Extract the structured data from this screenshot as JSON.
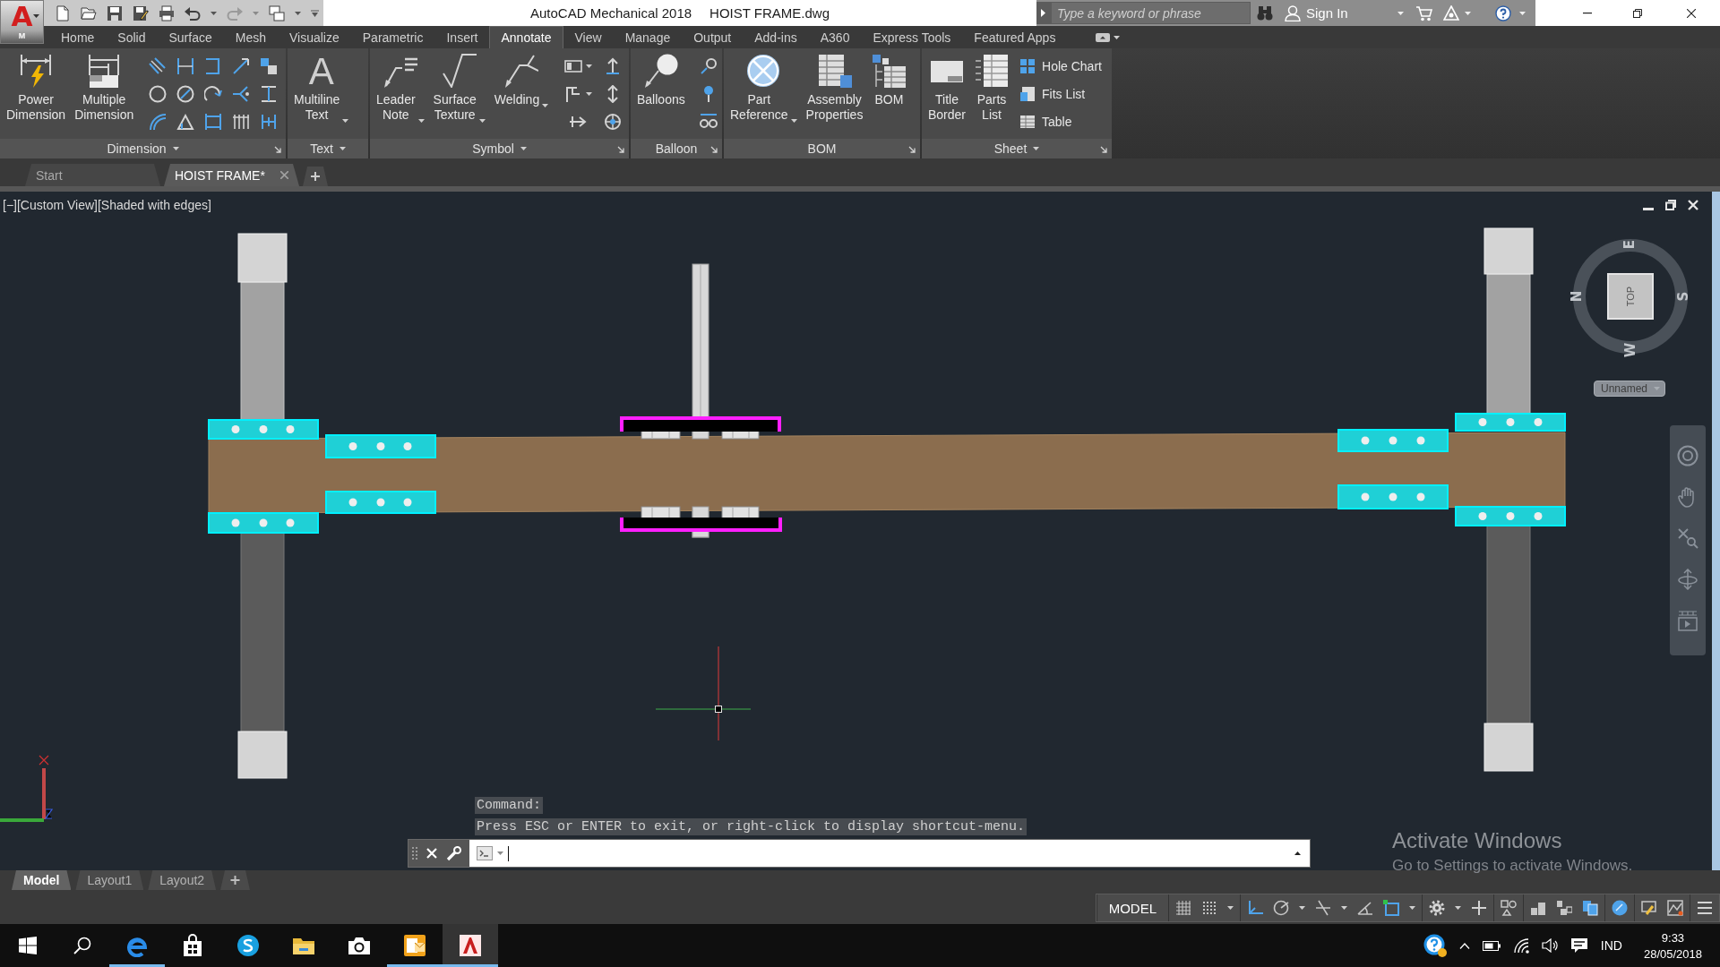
{
  "app_button": {
    "letter": "A",
    "badge": "M"
  },
  "title_bar": {
    "app": "AutoCAD Mechanical 2018",
    "document": "HOIST FRAME.dwg",
    "search": {
      "placeholder": "Type a keyword or phrase"
    },
    "sign_in": "Sign In"
  },
  "ribbon": {
    "tabs": [
      {
        "label": "Home",
        "selected": false
      },
      {
        "label": "Solid",
        "selected": false
      },
      {
        "label": "Surface",
        "selected": false
      },
      {
        "label": "Mesh",
        "selected": false
      },
      {
        "label": "Visualize",
        "selected": false
      },
      {
        "label": "Parametric",
        "selected": false
      },
      {
        "label": "Insert",
        "selected": false
      },
      {
        "label": "Annotate",
        "selected": true
      },
      {
        "label": "View",
        "selected": false
      },
      {
        "label": "Manage",
        "selected": false
      },
      {
        "label": "Output",
        "selected": false
      },
      {
        "label": "Add-ins",
        "selected": false
      },
      {
        "label": "A360",
        "selected": false
      },
      {
        "label": "Express Tools",
        "selected": false
      },
      {
        "label": "Featured Apps",
        "selected": false
      }
    ],
    "panels": [
      {
        "title": "Dimension",
        "menu": true,
        "launcher": true,
        "buttons": [
          {
            "label": "Power Dimension",
            "dropdown": false
          },
          {
            "label": "Multiple Dimension",
            "dropdown": false
          }
        ]
      },
      {
        "title": "Text",
        "menu": true,
        "launcher": false,
        "buttons": [
          {
            "label": "Multiline Text",
            "glyph": "A",
            "dropdown": true
          }
        ]
      },
      {
        "title": "Symbol",
        "menu": true,
        "launcher": true,
        "buttons": [
          {
            "label": "Leader Note",
            "dropdown": true
          },
          {
            "label": "Surface Texture",
            "dropdown": true
          },
          {
            "label": "Welding",
            "dropdown": true
          }
        ]
      },
      {
        "title": "Balloon",
        "menu": false,
        "launcher": true,
        "buttons": [
          {
            "label": "Balloons",
            "dropdown": false
          }
        ]
      },
      {
        "title": "BOM",
        "menu": false,
        "launcher": true,
        "buttons": [
          {
            "label": "Part Reference",
            "dropdown": true
          },
          {
            "label": "Assembly Properties",
            "dropdown": false
          },
          {
            "label": "BOM",
            "dropdown": false
          }
        ]
      },
      {
        "title": "Sheet",
        "menu": true,
        "launcher": true,
        "buttons": [
          {
            "label": "Title Border",
            "dropdown": false
          },
          {
            "label": "Parts List",
            "dropdown": false
          }
        ],
        "small_buttons": [
          {
            "label": "Hole Chart"
          },
          {
            "label": "Fits List"
          },
          {
            "label": "Table"
          }
        ]
      }
    ]
  },
  "file_tabs": [
    {
      "label": "Start",
      "selected": false,
      "closable": false
    },
    {
      "label": "HOIST FRAME*",
      "selected": true,
      "closable": true
    }
  ],
  "viewport": {
    "controls": [
      "[−]",
      "[Custom View]",
      "[Shaded with edges]"
    ],
    "viewcube": {
      "face": "TOP",
      "north": "N",
      "east": "E",
      "south": "S",
      "west": "W",
      "ucs_menu": "Unnamed"
    }
  },
  "command_line": {
    "history": [
      "Command:",
      "Press ESC or ENTER to exit, or right-click to display shortcut-menu."
    ]
  },
  "activation_notice": {
    "title": "Activate Windows",
    "message": "Go to Settings to activate Windows."
  },
  "layout_tabs": [
    {
      "label": "Model",
      "selected": true
    },
    {
      "label": "Layout1",
      "selected": false
    },
    {
      "label": "Layout2",
      "selected": false
    }
  ],
  "status_bar": {
    "space": "MODEL",
    "toggles": [
      {
        "on": false
      },
      {
        "on": false
      },
      {
        "on": true
      },
      {
        "on": false
      },
      {
        "on": false
      },
      {
        "on": false
      },
      {
        "on": true
      },
      {
        "on": false
      },
      {
        "on": false
      },
      {
        "on": false
      },
      {
        "on": true
      },
      {
        "on": true
      },
      {
        "on": false
      },
      {
        "on": false
      }
    ]
  },
  "taskbar": {
    "apps": [
      {
        "kind": "browser",
        "running": true,
        "active": false
      },
      {
        "kind": "store",
        "running": false,
        "active": false
      },
      {
        "kind": "chat",
        "running": false,
        "active": false
      },
      {
        "kind": "folder",
        "running": false,
        "active": false
      },
      {
        "kind": "camera",
        "running": false,
        "active": false
      },
      {
        "kind": "mail",
        "running": true,
        "active": false
      },
      {
        "kind": "cad",
        "running": true,
        "active": true
      }
    ],
    "tray": {
      "language": "IND",
      "time": "9:33",
      "date": "28/05/2018"
    }
  }
}
